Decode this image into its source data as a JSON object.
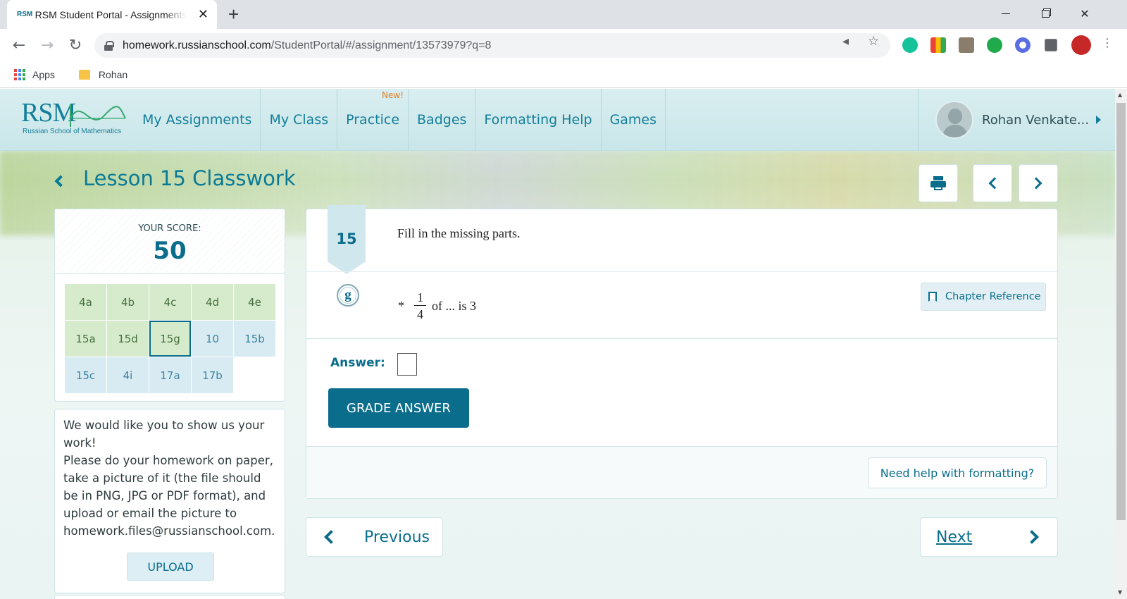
{
  "browser": {
    "tab_favicon": "RSM",
    "tab_title": "RSM Student Portal - Assignments",
    "tab_close": "✕",
    "new_tab": "+",
    "url_host": "homework.russianschool.com",
    "url_path": "/StudentPortal/#/assignment/13573979?q=8",
    "bookmarks": [
      {
        "label": "Apps"
      },
      {
        "label": "Rohan"
      }
    ]
  },
  "header": {
    "logo": "RSM",
    "logo_sub": "Russian School of Mathematics",
    "nav": [
      {
        "label": "My Assignments"
      },
      {
        "label": "My Class"
      },
      {
        "label": "Practice",
        "badge": "New!"
      },
      {
        "label": "Badges"
      },
      {
        "label": "Formatting Help"
      },
      {
        "label": "Games"
      }
    ],
    "user_name": "Rohan Venkate..."
  },
  "lesson": {
    "title": "Lesson 15 Classwork"
  },
  "score": {
    "label": "YOUR SCORE:",
    "value": "50",
    "questions": [
      {
        "label": "4a",
        "status": "green"
      },
      {
        "label": "4b",
        "status": "green"
      },
      {
        "label": "4c",
        "status": "green"
      },
      {
        "label": "4d",
        "status": "green"
      },
      {
        "label": "4e",
        "status": "green"
      },
      {
        "label": "15a",
        "status": "green"
      },
      {
        "label": "15d",
        "status": "green"
      },
      {
        "label": "15g",
        "status": "current"
      },
      {
        "label": "10",
        "status": "blue"
      },
      {
        "label": "15b",
        "status": "blue"
      },
      {
        "label": "15c",
        "status": "blue"
      },
      {
        "label": "4i",
        "status": "blue"
      },
      {
        "label": "17a",
        "status": "blue"
      },
      {
        "label": "17b",
        "status": "blue"
      }
    ]
  },
  "info": {
    "text": "We would like you to show us your work!\nPlease do your homework on paper, take a picture of it (the file should be in PNG, JPG or PDF format), and upload or email the picture to homework.files@russianschool.com.",
    "upload_label": "UPLOAD"
  },
  "question": {
    "number": "15",
    "prompt": "Fill in the missing parts.",
    "part": "g",
    "star": "*",
    "numerator": "1",
    "denominator": "4",
    "rest": "of ... is 3",
    "chapter_ref_label": "Chapter Reference",
    "answer_label": "Answer:",
    "grade_label": "GRADE ANSWER",
    "help_label": "Need help with formatting?"
  },
  "pager": {
    "prev_label": "Previous",
    "next_label": "Next"
  },
  "colors": {
    "accent": "#0a6d8c",
    "answered": "#d5ebcc",
    "unanswered": "#d9ebf2"
  }
}
